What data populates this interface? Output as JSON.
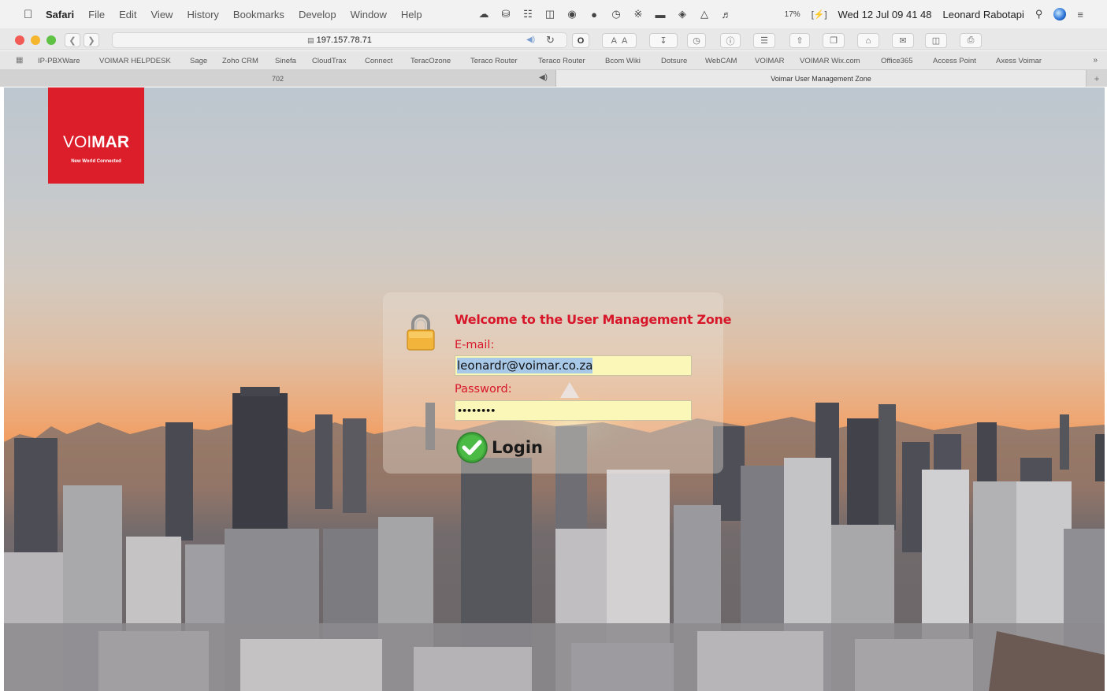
{
  "menubar": {
    "app_name": "Safari",
    "items": [
      "File",
      "Edit",
      "View",
      "History",
      "Bookmarks",
      "Develop",
      "Window",
      "Help"
    ],
    "battery": "17%",
    "clock": "Wed 12 Jul  09 41 48",
    "user": "Leonard Rabotapi"
  },
  "toolbar": {
    "url": "197.157.78.71"
  },
  "favorites": [
    "IP-PBXWare",
    "VOIMAR HELPDESK",
    "Sage",
    "Zoho CRM",
    "Sinefa",
    "CloudTrax",
    "Connect",
    "TeracOzone",
    "Teraco Router",
    "Teraco Router",
    "Bcom Wiki",
    "Dotsure",
    "WebCAM",
    "VOIMAR",
    "VOIMAR Wix.com",
    "Office365",
    "Access Point",
    "Axess Voimar"
  ],
  "tabs": [
    {
      "title": "702"
    },
    {
      "title": "Voimar User Management Zone"
    }
  ],
  "logo": {
    "name_light": "VOI",
    "name_bold": "MAR",
    "tagline": "New World Connected",
    "color": "#dc1e2a"
  },
  "login": {
    "welcome": "Welcome to the User Management Zone",
    "email_label": "E-mail:",
    "email_value": "leonardr@voimar.co.za",
    "password_label": "Password:",
    "password_value": "••••••••",
    "button_label": "Login",
    "accent_color": "#d8162a",
    "field_color": "#fbf7b8"
  }
}
